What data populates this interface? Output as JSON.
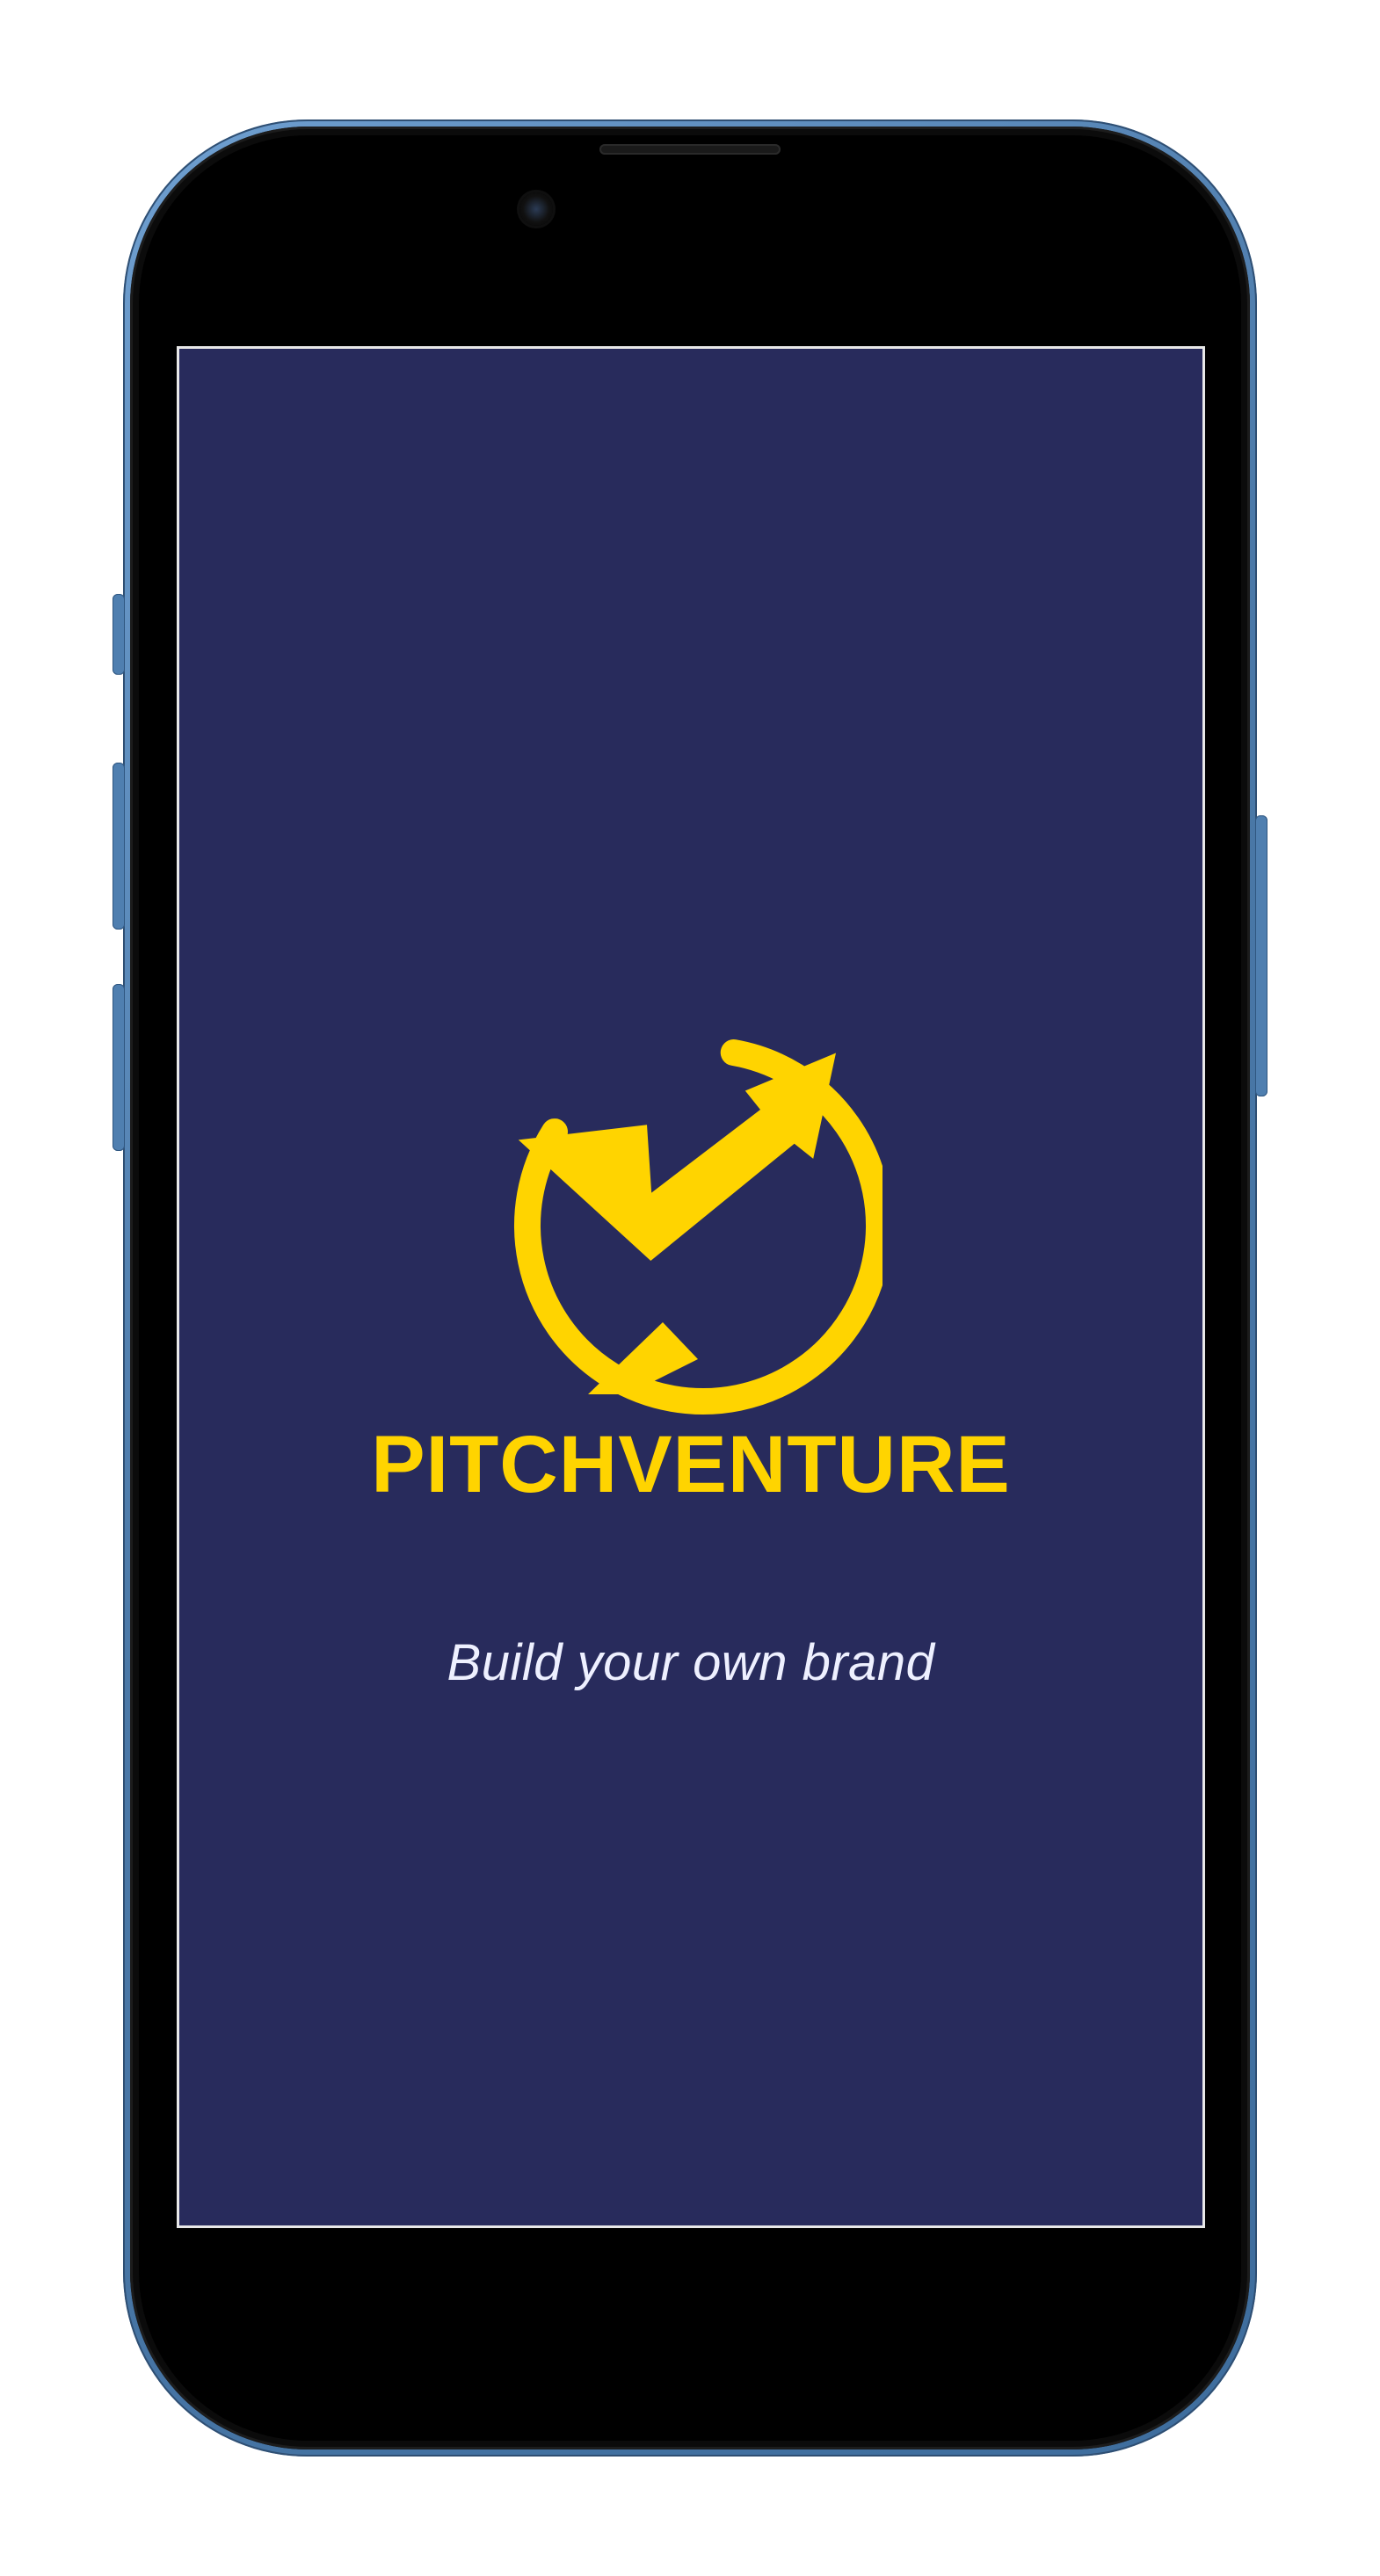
{
  "app": {
    "brand_name": "PITCHVENTURE",
    "tagline": "Build your own brand"
  },
  "theme": {
    "background_color": "#282b5c",
    "brand_color": "#ffd400",
    "tagline_color": "#eef0ff"
  },
  "icons": {
    "logo": "pitchventure-logo-icon"
  }
}
